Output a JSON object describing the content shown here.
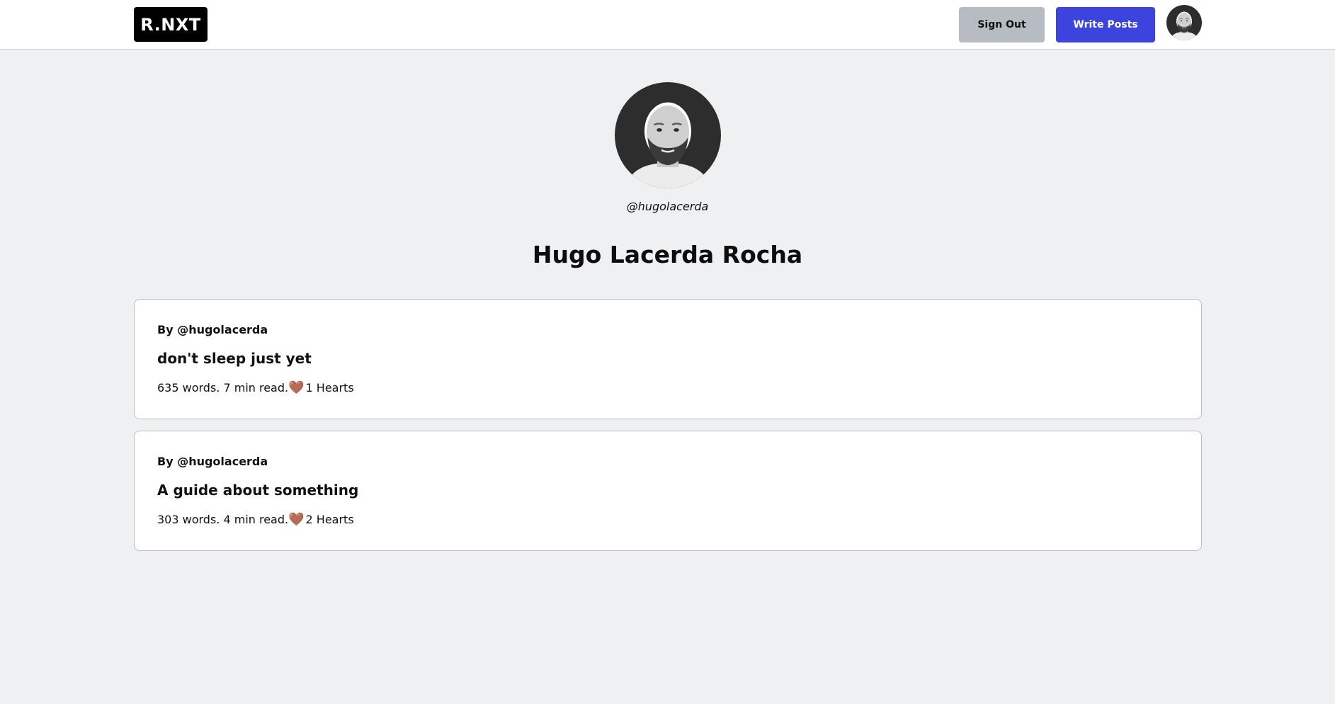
{
  "header": {
    "logo": "R.NXT",
    "sign_out_label": "Sign Out",
    "write_posts_label": "Write Posts"
  },
  "profile": {
    "username": "@hugolacerda",
    "full_name": "Hugo Lacerda Rocha"
  },
  "posts": [
    {
      "author": "By @hugolacerda",
      "title": "don't sleep just yet",
      "stats": "635 words. 7 min read.",
      "hearts": "1 Hearts"
    },
    {
      "author": "By @hugolacerda",
      "title": "A guide about something",
      "stats": "303 words. 4 min read.",
      "hearts": "2 Hearts"
    }
  ],
  "icons": {
    "heart": "heart-icon",
    "avatar": "avatar"
  },
  "colors": {
    "accent": "#3c44dd",
    "secondary_button": "#b6bcc2",
    "logo_bg": "#000000",
    "page_bg": "#eef0f2",
    "heart": "#b0714e"
  }
}
